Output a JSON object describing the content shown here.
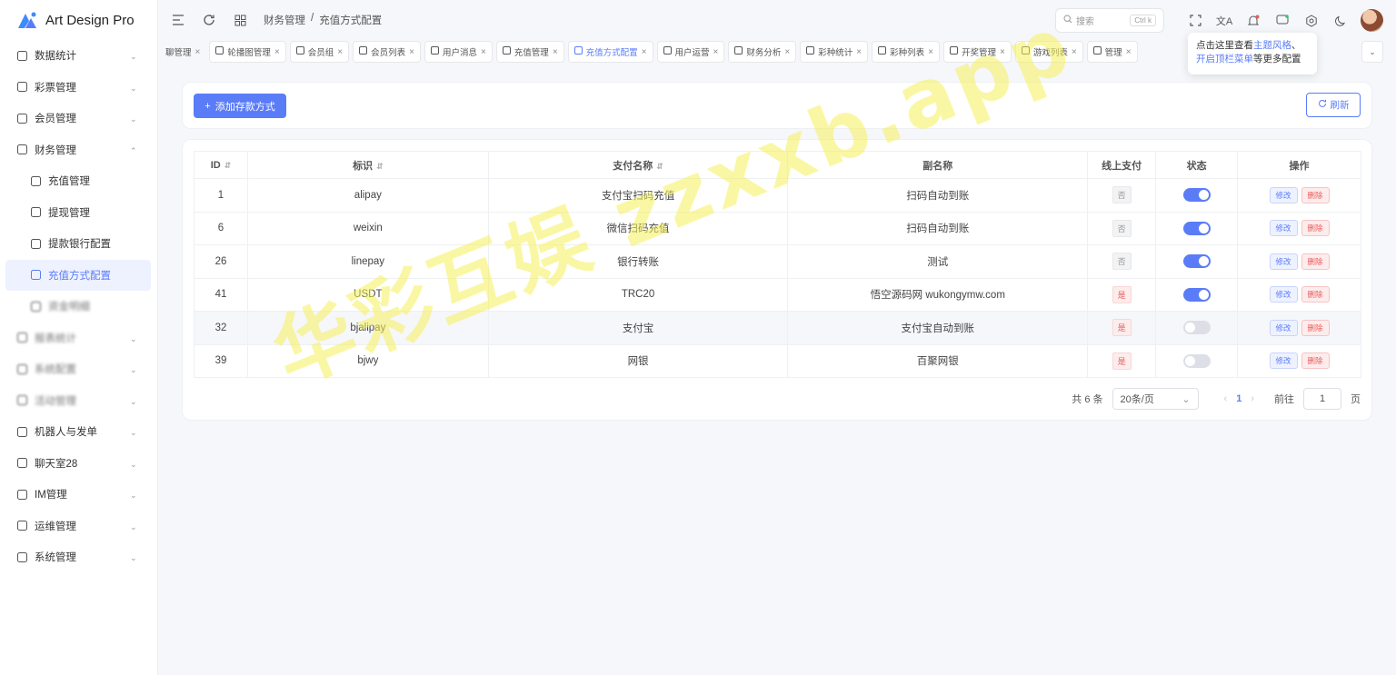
{
  "app": {
    "title": "Art Design Pro"
  },
  "sidebar": {
    "items": [
      {
        "label": "数据统计",
        "icon": "chart-icon",
        "expanded": false
      },
      {
        "label": "彩票管理",
        "icon": "ticket-icon",
        "expanded": false
      },
      {
        "label": "会员管理",
        "icon": "user-icon",
        "expanded": false
      },
      {
        "label": "财务管理",
        "icon": "wallet-icon",
        "expanded": true
      },
      {
        "label": "充值管理",
        "icon": "coins-icon",
        "sub": true
      },
      {
        "label": "提现管理",
        "icon": "card-icon",
        "sub": true
      },
      {
        "label": "提款银行配置",
        "icon": "bank-icon",
        "sub": true
      },
      {
        "label": "充值方式配置",
        "icon": "gear-icon",
        "sub": true,
        "active": true
      },
      {
        "label": "资金明细",
        "icon": "blurred-icon",
        "sub": true,
        "blurred": true
      },
      {
        "label": "报表统计",
        "icon": "blurred-icon",
        "blurred": true
      },
      {
        "label": "系统配置",
        "icon": "blurred-icon",
        "blurred": true
      },
      {
        "label": "活动管理",
        "icon": "blurred-icon",
        "blurred": true
      },
      {
        "label": "机器人与发单",
        "icon": "robot-icon",
        "expanded": false
      },
      {
        "label": "聊天室28",
        "icon": "chat-icon",
        "expanded": false
      },
      {
        "label": "IM管理",
        "icon": "message-icon",
        "expanded": false
      },
      {
        "label": "运维管理",
        "icon": "tools-icon",
        "expanded": false
      },
      {
        "label": "系统管理",
        "icon": "user-icon",
        "expanded": false
      }
    ]
  },
  "header": {
    "breadcrumb": [
      "财务管理",
      "/",
      "充值方式配置"
    ],
    "search_placeholder": "搜索",
    "search_kbd": "Ctrl k"
  },
  "tabs": [
    {
      "label": "聊管理",
      "first": true
    },
    {
      "label": "轮播图管理"
    },
    {
      "label": "会员组"
    },
    {
      "label": "会员列表"
    },
    {
      "label": "用户消息"
    },
    {
      "label": "充值管理"
    },
    {
      "label": "充值方式配置",
      "active": true
    },
    {
      "label": "用户运营"
    },
    {
      "label": "财务分析"
    },
    {
      "label": "彩种统计"
    },
    {
      "label": "彩种列表"
    },
    {
      "label": "开奖管理"
    },
    {
      "label": "游戏列表"
    },
    {
      "label": "管理"
    }
  ],
  "tooltip": {
    "prefix": "点击这里查看",
    "link1": "主题风格",
    "sep": "、",
    "link2": "开启顶栏菜单",
    "suffix": "等更多配置"
  },
  "toolbar": {
    "add_label": "添加存款方式",
    "refresh_label": "刷新"
  },
  "table": {
    "columns": [
      "ID",
      "标识",
      "支付名称",
      "副名称",
      "线上支付",
      "状态",
      "操作"
    ],
    "rows": [
      {
        "id": "1",
        "code": "alipay",
        "name": "支付宝扫码充值",
        "subname": "扫码自动到账",
        "online": "否",
        "status": true
      },
      {
        "id": "6",
        "code": "weixin",
        "name": "微信扫码充值",
        "subname": "扫码自动到账",
        "online": "否",
        "status": true
      },
      {
        "id": "26",
        "code": "linepay",
        "name": "银行转账",
        "subname": "测试",
        "online": "否",
        "status": true
      },
      {
        "id": "41",
        "code": "USDT",
        "name": "TRC20",
        "subname": "悟空源码网 wukongymw.com",
        "online": "是",
        "status": true
      },
      {
        "id": "32",
        "code": "bjalipay",
        "name": "支付宝",
        "subname": "支付宝自动到账",
        "online": "是",
        "status": false
      },
      {
        "id": "39",
        "code": "bjwy",
        "name": "网银",
        "subname": "百聚网银",
        "online": "是",
        "status": false
      }
    ],
    "edit_label": "修改",
    "delete_label": "删除"
  },
  "pagination": {
    "total": "共 6 条",
    "page_size": "20条/页",
    "current": "1",
    "goto_label": "前往",
    "goto_value": "1",
    "page_suffix": "页"
  },
  "watermark": "华彩互娱 zzxxb.app",
  "colors": {
    "accent": "#5a7cf7",
    "danger": "#e85c5c"
  }
}
